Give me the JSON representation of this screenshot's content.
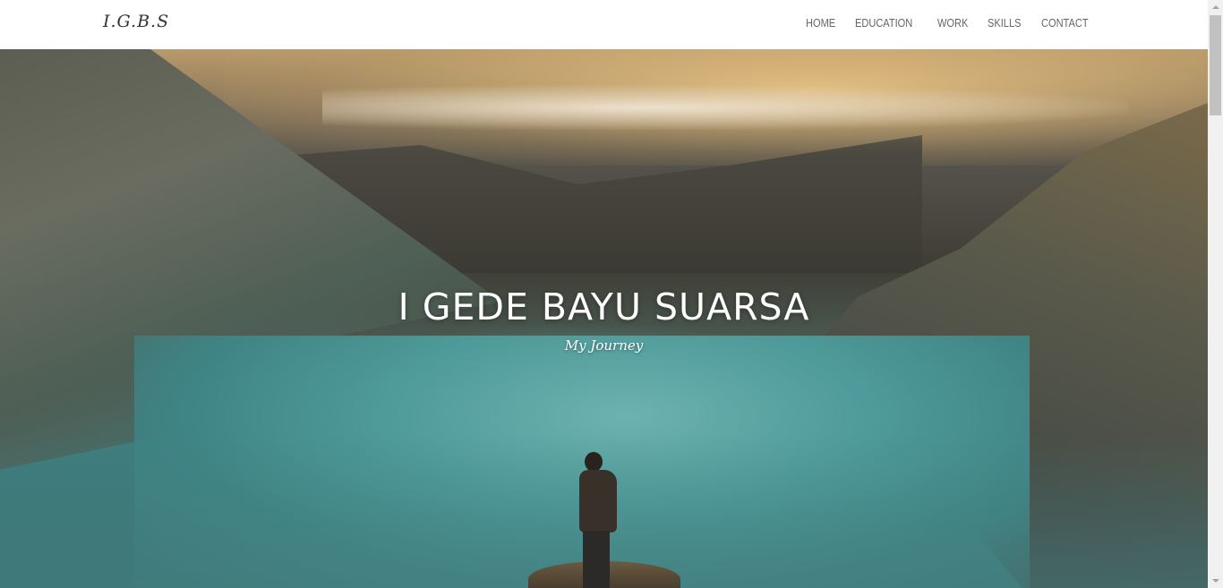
{
  "navbar": {
    "brand": "I.G.B.S",
    "items": [
      {
        "label": "HOME"
      },
      {
        "label": "EDUCATION"
      },
      {
        "label": "WORK"
      },
      {
        "label": "SKILLS"
      },
      {
        "label": "CONTACT"
      }
    ]
  },
  "hero": {
    "title": "I GEDE BAYU SUARSA",
    "subtitle": "My Journey"
  },
  "colors": {
    "navbar_bg": "#ffffff",
    "nav_text": "#666666",
    "hero_text": "#ffffff",
    "lake_teal": "#4f9a9a"
  }
}
